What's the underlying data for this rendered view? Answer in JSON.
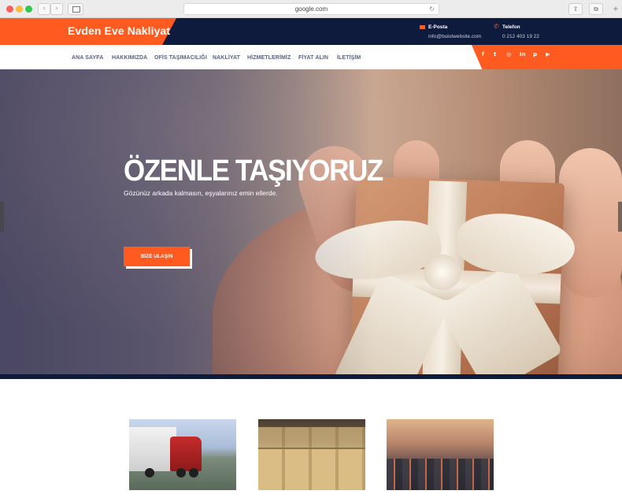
{
  "browser": {
    "url": "google.com",
    "back_glyph": "‹",
    "forward_glyph": "›",
    "reload_glyph": "↻",
    "share_glyph": "⇧",
    "tabs_glyph": "⧉",
    "plus_glyph": "+"
  },
  "header": {
    "brand": "Evden Eve Nakliyat",
    "email_label": "E-Posta",
    "email_value": "info@bulutwebsite.com",
    "phone_label": "Telefon",
    "phone_value": "0 212 403 19 22",
    "phone_glyph": "✆"
  },
  "nav": {
    "items": [
      "ANA SAYFA",
      "HAKKIMIZDA",
      "OFİS TAŞIMACILIĞI",
      "NAKLİYAT",
      "HİZMETLERİMİZ",
      "FİYAT ALIN",
      "İLETİŞİM"
    ]
  },
  "social": {
    "icons": [
      "f",
      "t",
      "◎",
      "in",
      "p",
      "▶"
    ]
  },
  "hero": {
    "title": "ÖZENLE TAŞIYORUZ",
    "subtitle": "Gözünüz arkada kalmasın, eşyalarınız emin ellerde.",
    "cta_label": "BİZE ULAŞIN"
  },
  "colors": {
    "accent": "#ff5a1f",
    "navy": "#0e1b3d"
  }
}
